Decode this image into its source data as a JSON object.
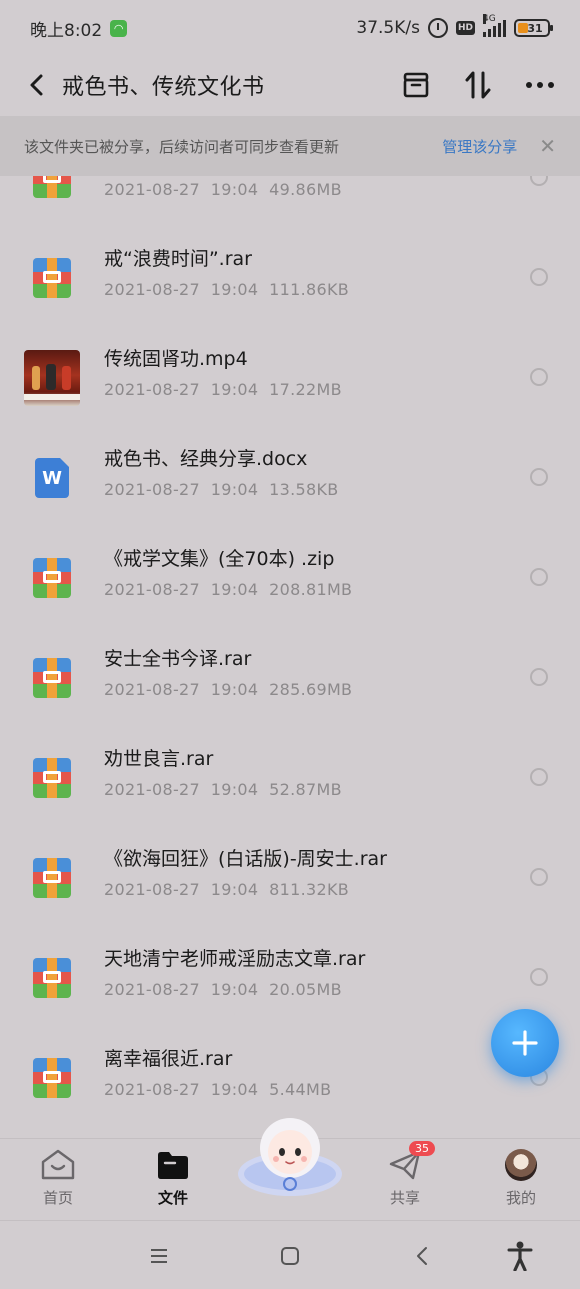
{
  "status_bar": {
    "time": "晚上8:02",
    "net_speed": "37.5K/s",
    "hd_label": "HD",
    "network_type": "4G",
    "battery": "31"
  },
  "header": {
    "title": "戒色书、传统文化书"
  },
  "banner": {
    "text": "该文件夹已被分享，后续访问者可同步查看更新",
    "manage_label": "管理该分享",
    "close_glyph": "✕"
  },
  "files": [
    {
      "name": "",
      "date": "2021-08-27",
      "time": "19:04",
      "size": "49.86MB",
      "type": "archive-icon"
    },
    {
      "name": "戒“浪费时间”.rar",
      "date": "2021-08-27",
      "time": "19:04",
      "size": "111.86KB",
      "type": "archive-icon"
    },
    {
      "name": "传统固肾功.mp4",
      "date": "2021-08-27",
      "time": "19:04",
      "size": "17.22MB",
      "type": "video-thumbnail"
    },
    {
      "name": "戒色书、经典分享.docx",
      "date": "2021-08-27",
      "time": "19:04",
      "size": "13.58KB",
      "type": "word-icon"
    },
    {
      "name": "《戒学文集》(全70本) .zip",
      "date": "2021-08-27",
      "time": "19:04",
      "size": "208.81MB",
      "type": "archive-icon"
    },
    {
      "name": "安士全书今译.rar",
      "date": "2021-08-27",
      "time": "19:04",
      "size": "285.69MB",
      "type": "archive-icon"
    },
    {
      "name": "劝世良言.rar",
      "date": "2021-08-27",
      "time": "19:04",
      "size": "52.87MB",
      "type": "archive-icon"
    },
    {
      "name": "《欲海回狂》(白话版)-周安士.rar",
      "date": "2021-08-27",
      "time": "19:04",
      "size": "811.32KB",
      "type": "archive-icon"
    },
    {
      "name": "天地清宁老师戒淫励志文章.rar",
      "date": "2021-08-27",
      "time": "19:04",
      "size": "20.05MB",
      "type": "archive-icon"
    },
    {
      "name": "离幸福很近.rar",
      "date": "2021-08-27",
      "time": "19:04",
      "size": "5.44MB",
      "type": "archive-icon"
    }
  ],
  "word_glyph": "W",
  "bottom_nav": {
    "home": "首页",
    "files": "文件",
    "share": "共享",
    "share_badge": "35",
    "me": "我的"
  },
  "colors": {
    "background": "#d2cdd0",
    "accent": "#3a78c4",
    "fab": "#2a86e0",
    "badge": "#ee4b50"
  }
}
